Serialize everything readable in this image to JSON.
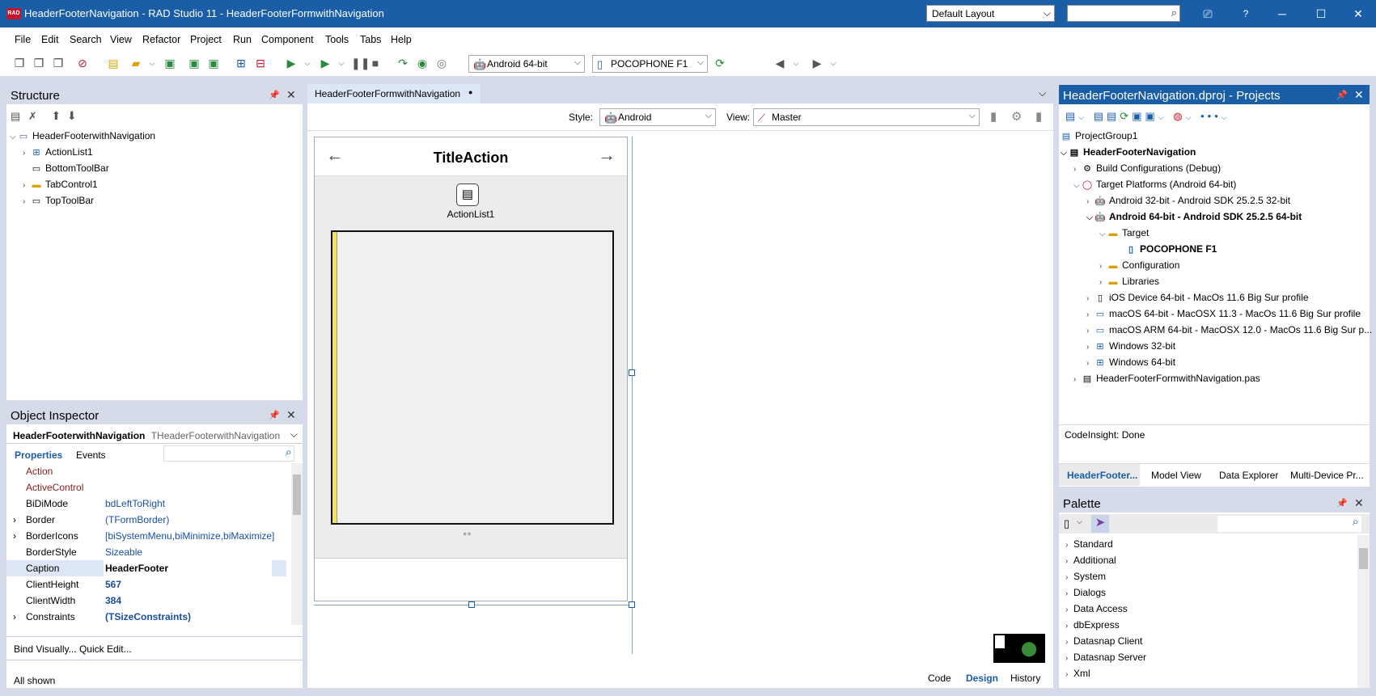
{
  "app": {
    "title": "HeaderFooterNavigation - RAD Studio 11 - HeaderFooterFormwithNavigation",
    "layout": "Default Layout",
    "help": "?"
  },
  "menu": [
    "File",
    "Edit",
    "Search",
    "View",
    "Refactor",
    "Project",
    "Run",
    "Component",
    "Tools",
    "Tabs",
    "Help"
  ],
  "toolbar": {
    "platform": "Android 64-bit",
    "device": "POCOPHONE F1"
  },
  "structure": {
    "title": "Structure",
    "root": "HeaderFooterwithNavigation",
    "items": [
      "ActionList1",
      "BottomToolBar",
      "TabControl1",
      "TopToolBar"
    ]
  },
  "inspector": {
    "title": "Object Inspector",
    "object": "HeaderFooterwithNavigation",
    "class": "THeaderFooterwithNavigation",
    "tab_properties": "Properties",
    "tab_events": "Events",
    "rows": [
      {
        "name": "Action",
        "value": ""
      },
      {
        "name": "ActiveControl",
        "value": ""
      },
      {
        "name": "BiDiMode",
        "value": "bdLeftToRight"
      },
      {
        "name": "Border",
        "value": "(TFormBorder)"
      },
      {
        "name": "BorderIcons",
        "value": "[biSystemMenu,biMinimize,biMaximize]"
      },
      {
        "name": "BorderStyle",
        "value": "Sizeable"
      },
      {
        "name": "Caption",
        "value": "HeaderFooter"
      },
      {
        "name": "ClientHeight",
        "value": "567"
      },
      {
        "name": "ClientWidth",
        "value": "384"
      },
      {
        "name": "Constraints",
        "value": "(TSizeConstraints)"
      }
    ],
    "bind": "Bind Visually...",
    "quick": "Quick Edit...",
    "status": "All shown"
  },
  "designer": {
    "tab": "HeaderFooterFormwithNavigation",
    "style_label": "Style:",
    "style": "Android",
    "view_label": "View:",
    "view": "Master",
    "form_title": "TitleAction",
    "component": "ActionList1",
    "tabs": [
      "Code",
      "Design",
      "History"
    ]
  },
  "projects": {
    "title": "HeaderFooterNavigation.dproj - Projects",
    "status": "CodeInsight: Done",
    "items": [
      "ProjectGroup1",
      "HeaderFooterNavigation",
      "Build Configurations (Debug)",
      "Target Platforms (Android 64-bit)",
      "Android 32-bit - Android SDK 25.2.5 32-bit",
      "Android 64-bit - Android SDK 25.2.5 64-bit",
      "Target",
      "POCOPHONE F1",
      "Configuration",
      "Libraries",
      "iOS Device 64-bit - MacOs 11.6 Big Sur profile",
      "macOS 64-bit - MacOSX 11.3 - MacOs 11.6 Big Sur profile",
      "macOS ARM 64-bit - MacOSX 12.0 - MacOs 11.6 Big Sur p...",
      "Windows 32-bit",
      "Windows 64-bit",
      "HeaderFooterFormwithNavigation.pas"
    ],
    "tabs": [
      "HeaderFooter...",
      "Model View",
      "Data Explorer",
      "Multi-Device Pr..."
    ]
  },
  "palette": {
    "title": "Palette",
    "items": [
      "Standard",
      "Additional",
      "System",
      "Dialogs",
      "Data Access",
      "dbExpress",
      "Datasnap Client",
      "Datasnap Server",
      "Xml"
    ]
  }
}
